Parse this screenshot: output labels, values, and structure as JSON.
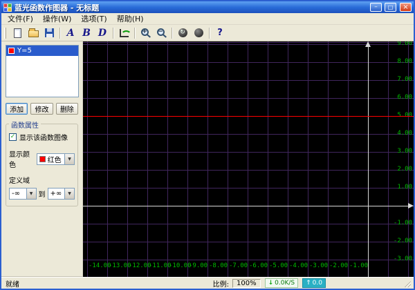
{
  "window": {
    "title": "蓝光函数作图器 - 无标题",
    "icon_colors": [
      "#e04040",
      "#40b840",
      "#4060e0",
      "#e8c020"
    ]
  },
  "menu": {
    "items": [
      "文件(F)",
      "操作(W)",
      "选项(T)",
      "帮助(H)"
    ]
  },
  "toolbar": {
    "icons": [
      {
        "name": "new",
        "type": "new",
        "glyph": "",
        "sep": false
      },
      {
        "name": "open",
        "type": "open",
        "glyph": "",
        "sep": false
      },
      {
        "name": "save",
        "type": "save",
        "glyph": "",
        "sep": true
      },
      {
        "name": "font-a",
        "type": "letter",
        "glyph": "A",
        "sep": false
      },
      {
        "name": "font-b",
        "type": "letter",
        "glyph": "B",
        "sep": false
      },
      {
        "name": "font-d",
        "type": "letter",
        "glyph": "D",
        "sep": true
      },
      {
        "name": "plot-axes",
        "type": "axes",
        "glyph": "",
        "sep": true
      },
      {
        "name": "zoom-in",
        "type": "zoom",
        "glyph": "+",
        "sep": false
      },
      {
        "name": "zoom-out",
        "type": "zoom",
        "glyph": "−",
        "sep": true
      },
      {
        "name": "refresh",
        "type": "round",
        "glyph": "↻",
        "sep": false
      },
      {
        "name": "timer",
        "type": "round",
        "glyph": "",
        "sep": true
      },
      {
        "name": "help",
        "type": "help",
        "glyph": "?",
        "sep": false
      }
    ]
  },
  "sidebar": {
    "functions": [
      {
        "label": "Y=5",
        "color": "#ff0000",
        "selected": true
      }
    ],
    "buttons": {
      "add": "添加",
      "modify": "修改",
      "delete": "删除"
    },
    "properties": {
      "title": "函数属性",
      "show_label": "显示该函数图像",
      "show_checked": true,
      "color_label": "显示颜色",
      "color_value": "红色",
      "color_swatch": "#ff0000",
      "domain_label": "定义域",
      "domain_from": "-∞",
      "to_label": "到",
      "domain_to": "+∞"
    }
  },
  "chart_data": {
    "type": "line",
    "title": "",
    "xlabel": "",
    "ylabel": "",
    "grid": true,
    "background": "#000000",
    "grid_color": "#41265e",
    "axis_color": "#d9d9d9",
    "tick_label_color": "#00bb00",
    "x_ticks": [
      -14,
      -13,
      -12,
      -11,
      -10,
      -9,
      -8,
      -7,
      -6,
      -5,
      -4,
      -3,
      -2,
      -1
    ],
    "y_ticks": [
      9,
      8,
      7,
      6,
      5,
      4,
      3,
      2,
      1,
      -1,
      -2,
      -3
    ],
    "x_visible_range": [
      -14.3,
      2.3
    ],
    "y_visible_range": [
      -3.9,
      9.2
    ],
    "functions": [
      {
        "label": "Y=5",
        "expression": "y = 5",
        "color": "#ff0000",
        "y_value": 5
      }
    ]
  },
  "statusbar": {
    "ready": "就绪",
    "scale_label": "比例:",
    "scale_value": "100%",
    "net_down_value": "0.0K/S",
    "net_up_value": "0.0"
  }
}
